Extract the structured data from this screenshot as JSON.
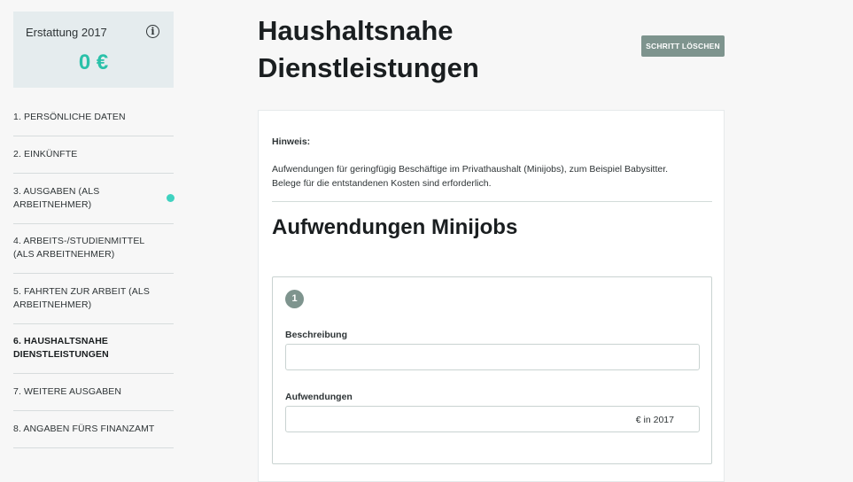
{
  "refund": {
    "title": "Erstattung 2017",
    "amount": "0 €",
    "info_icon": "info-icon"
  },
  "nav": {
    "items": [
      {
        "label": "1. PERSÖNLICHE DATEN"
      },
      {
        "label": "2. EINKÜNFTE"
      },
      {
        "label": "3. AUSGABEN (ALS ARBEITNEHMER)",
        "has_dot": true
      },
      {
        "label": "4. ARBEITS-/STUDIENMITTEL (ALS ARBEITNEHMER)"
      },
      {
        "label": "5. FAHRTEN ZUR ARBEIT (ALS ARBEITNEHMER)"
      },
      {
        "label": "6. HAUSHALTSNAHE DIENSTLEISTUNGEN",
        "active": true
      },
      {
        "label": "7. WEITERE AUSGABEN"
      },
      {
        "label": "8. ANGABEN FÜRS FINANZAMT"
      }
    ]
  },
  "header": {
    "title": "Haushaltsnahe Dienstleistungen",
    "delete_label": "SCHRITT LÖSCHEN"
  },
  "hint": {
    "label": "Hinweis:",
    "text": "Aufwendungen für geringfügig Beschäftige im Privathaushalt (Minijobs), zum Beispiel Babysitter. Belege für die entstandenen Kosten sind erforderlich."
  },
  "section": {
    "title": "Aufwendungen Minijobs",
    "entry": {
      "number": "1",
      "description_label": "Beschreibung",
      "description_value": "",
      "expenses_label": "Aufwendungen",
      "expenses_value": "",
      "expenses_suffix": "€ in 2017"
    }
  },
  "colors": {
    "accent": "#2ac1a9",
    "button": "#7e948e",
    "dot": "#3fd2c0"
  }
}
